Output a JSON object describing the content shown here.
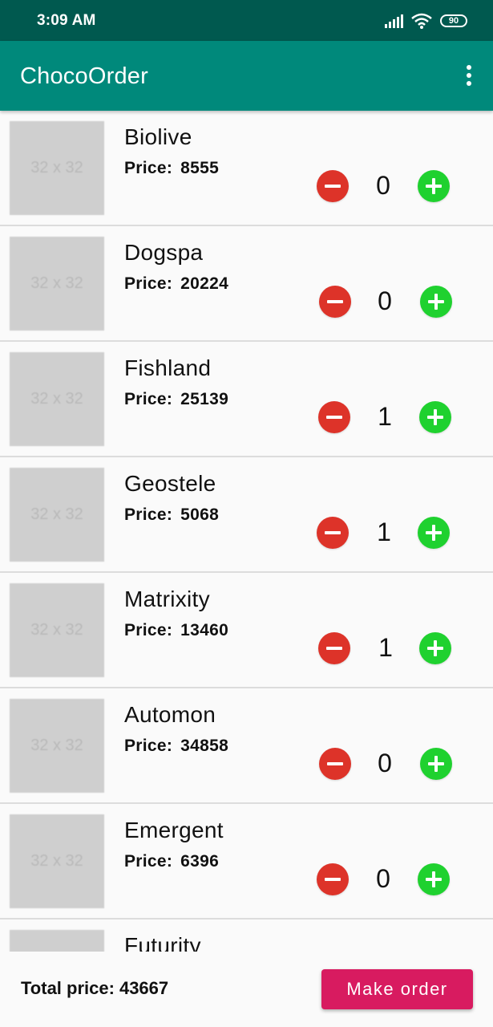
{
  "status_bar": {
    "time": "3:09 AM",
    "battery": "90"
  },
  "app_bar": {
    "title": "ChocoOrder",
    "menu_icon": "more-vert-icon"
  },
  "products": [
    {
      "name": "Biolive",
      "price_label": "Price:",
      "price": "8555",
      "qty": "0",
      "thumb": "32 x 32"
    },
    {
      "name": "Dogspa",
      "price_label": "Price:",
      "price": "20224",
      "qty": "0",
      "thumb": "32 x 32"
    },
    {
      "name": "Fishland",
      "price_label": "Price:",
      "price": "25139",
      "qty": "1",
      "thumb": "32 x 32"
    },
    {
      "name": "Geostele",
      "price_label": "Price:",
      "price": "5068",
      "qty": "1",
      "thumb": "32 x 32"
    },
    {
      "name": "Matrixity",
      "price_label": "Price:",
      "price": "13460",
      "qty": "1",
      "thumb": "32 x 32"
    },
    {
      "name": "Automon",
      "price_label": "Price:",
      "price": "34858",
      "qty": "0",
      "thumb": "32 x 32"
    },
    {
      "name": "Emergent",
      "price_label": "Price:",
      "price": "6396",
      "qty": "0",
      "thumb": "32 x 32"
    },
    {
      "name": "Futurity",
      "price_label": "",
      "price": "",
      "qty": "",
      "thumb": ""
    }
  ],
  "footer": {
    "total_label": "Total price:",
    "total_value": "43667",
    "order_button": "Make order"
  },
  "colors": {
    "status_bar": "#00594f",
    "app_bar": "#00897b",
    "minus": "#dd3329",
    "plus": "#1fd12f",
    "accent": "#d81b60"
  }
}
